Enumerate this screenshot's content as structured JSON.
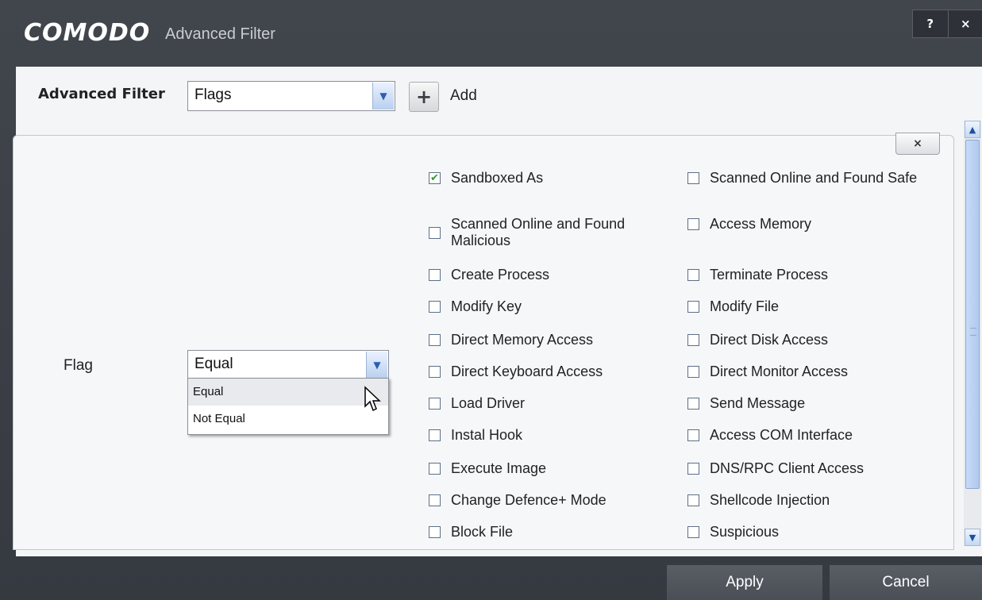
{
  "window": {
    "brand": "COMODO",
    "title": "Advanced Filter",
    "help_label": "?",
    "close_label": "×"
  },
  "filter_bar": {
    "label": "Advanced Filter",
    "selected": "Flags",
    "add_label": "Add"
  },
  "filter_box": {
    "close_label": "×",
    "flag_label": "Flag",
    "operator_selected": "Equal",
    "operator_options": [
      "Equal",
      "Not Equal"
    ]
  },
  "flags": {
    "left": [
      {
        "label": "Sandboxed As",
        "checked": true
      },
      {
        "label": "Scanned Online and Found Malicious",
        "checked": false
      },
      {
        "label": "Create Process",
        "checked": false
      },
      {
        "label": "Modify Key",
        "checked": false
      },
      {
        "label": "Direct Memory Access",
        "checked": false
      },
      {
        "label": "Direct Keyboard Access",
        "checked": false
      },
      {
        "label": "Load Driver",
        "checked": false
      },
      {
        "label": "Instal Hook",
        "checked": false
      },
      {
        "label": "Execute Image",
        "checked": false
      },
      {
        "label": "Change Defence+ Mode",
        "checked": false
      },
      {
        "label": "Block File",
        "checked": false
      }
    ],
    "right": [
      {
        "label": "Scanned Online and Found Safe",
        "checked": false
      },
      {
        "label": "Access Memory",
        "checked": false
      },
      {
        "label": "Terminate Process",
        "checked": false
      },
      {
        "label": "Modify File",
        "checked": false
      },
      {
        "label": "Direct Disk Access",
        "checked": false
      },
      {
        "label": "Direct Monitor Access",
        "checked": false
      },
      {
        "label": "Send Message",
        "checked": false
      },
      {
        "label": "Access COM Interface",
        "checked": false
      },
      {
        "label": "DNS/RPC Client Access",
        "checked": false
      },
      {
        "label": "Shellcode Injection",
        "checked": false
      },
      {
        "label": "Suspicious",
        "checked": false
      }
    ]
  },
  "footer": {
    "apply_label": "Apply",
    "cancel_label": "Cancel"
  }
}
